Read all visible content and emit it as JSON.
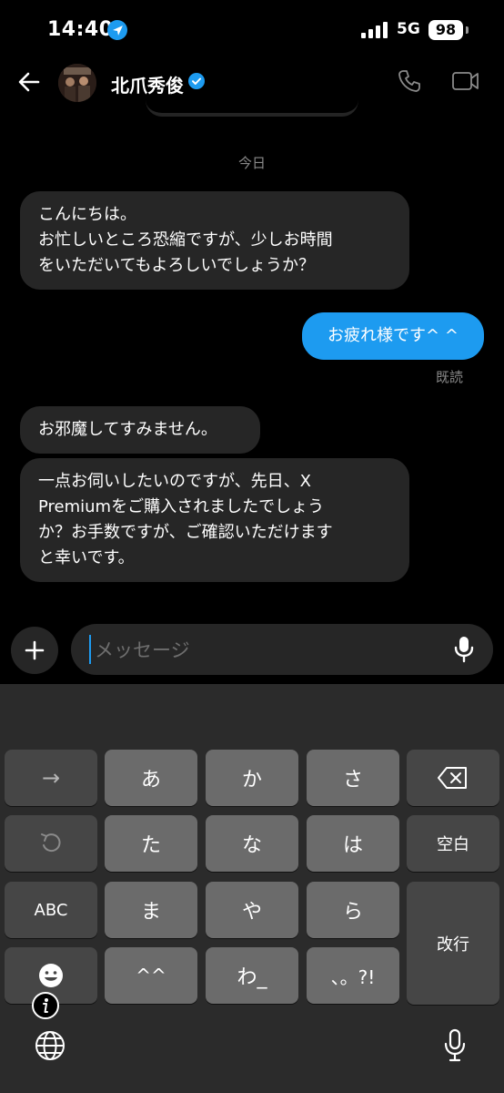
{
  "status_bar": {
    "time": "14:40",
    "network": "5G",
    "battery": "98"
  },
  "header": {
    "contact_name": "北爪秀俊"
  },
  "conversation": {
    "date_separator": "今日",
    "messages": [
      {
        "from": "them",
        "lines": [
          "こんにちは。",
          "お忙しいところ恐縮ですが、少しお時間",
          "をいただいてもよろしいでしょうか？"
        ]
      },
      {
        "from": "me",
        "text": "お疲れ様です^ ^",
        "status": "既読"
      },
      {
        "from": "them",
        "text": "お邪魔してすみません。"
      },
      {
        "from": "them",
        "lines": [
          "一点お伺いしたいのですが、先日、X",
          "Premiumをご購入されましたでしょう",
          "か？お手数ですが、ご確認いただけます",
          "と幸いです。"
        ]
      }
    ]
  },
  "composer": {
    "placeholder": "メッセージ"
  },
  "keyboard": {
    "row1": [
      "→",
      "あ",
      "か",
      "さ",
      "⌫"
    ],
    "row2": [
      "↺",
      "た",
      "な",
      "は",
      "空白"
    ],
    "row3": [
      "ABC",
      "ま",
      "や",
      "ら",
      "改行"
    ],
    "row4": [
      "☺",
      "^^",
      "わ_",
      "、。?!"
    ],
    "icons": [
      "info-icon",
      "globe-icon",
      "microphone-icon"
    ]
  },
  "colors": {
    "accent": "#1d9bf0",
    "bubble_in": "#262626",
    "background": "#000000",
    "key": "#6b6b6b",
    "key_dark": "#464646"
  }
}
